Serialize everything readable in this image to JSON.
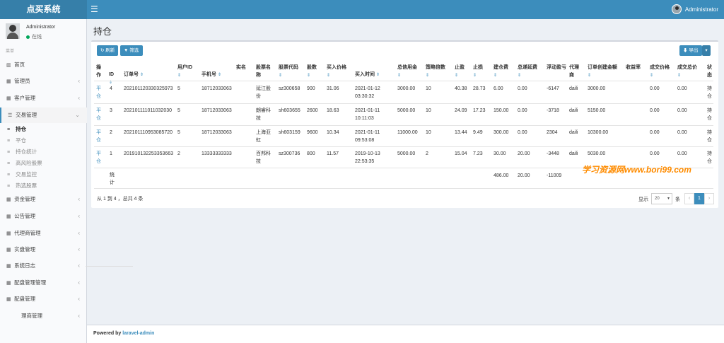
{
  "app": {
    "title": "点买系统",
    "user": "Administrator"
  },
  "sidebar": {
    "user_name": "Administrator",
    "status": "在线",
    "header": "菜单",
    "items": [
      {
        "label": "首页",
        "icon": "bar-chart-icon"
      },
      {
        "label": "管理员",
        "icon": "table-icon"
      },
      {
        "label": "客户管理",
        "icon": "table-icon"
      },
      {
        "label": "交易管理",
        "icon": "list-icon"
      }
    ],
    "sub_items": [
      {
        "label": "持仓"
      },
      {
        "label": "平仓"
      },
      {
        "label": "持仓统计"
      },
      {
        "label": "高风险股票"
      },
      {
        "label": "交易监控"
      },
      {
        "label": "热选股票"
      }
    ],
    "items_after": [
      {
        "label": "资金管理"
      },
      {
        "label": "公告管理"
      },
      {
        "label": "代理商管理"
      },
      {
        "label": "实盘管理"
      },
      {
        "label": "系统日志"
      },
      {
        "label": "配盘管理管理"
      },
      {
        "label": "配盘管理"
      },
      {
        "label": "理商管理"
      }
    ],
    "overlap_label": "管理"
  },
  "page": {
    "title": "持仓"
  },
  "toolbar": {
    "refresh": "刷新",
    "filter": "筛选",
    "export": "导出"
  },
  "table": {
    "headers": [
      "操作",
      "ID",
      "订单号",
      "用户ID",
      "手机号",
      "实名",
      "股票名称",
      "股票代码",
      "股数",
      "买入价格",
      "买入时间",
      "总信用金",
      "策略倍数",
      "止盈",
      "止损",
      "建仓费",
      "总递延费",
      "浮动盈亏",
      "代理商",
      "订单创建金额",
      "收益率",
      "成交价格",
      "成交总价",
      "状态"
    ],
    "rows": [
      {
        "action": "平仓",
        "id": "4",
        "order": "202101120330325973",
        "uid": "5",
        "phone": "18712033063",
        "name": "",
        "stock": "延江股份",
        "code": "sz300658",
        "shares": "900",
        "price": "31.06",
        "time": "2021-01-12 03:30:32",
        "credit": "3000.00",
        "multiple": "10",
        "tp": "40.38",
        "sl": "28.73",
        "fee": "6.00",
        "defer": "0.00",
        "pnl": "-6147",
        "agent": "daili",
        "amount": "3000.00",
        "rate": "",
        "deal_price": "0.00",
        "deal_total": "0.00",
        "status": "持仓"
      },
      {
        "action": "平仓",
        "id": "3",
        "order": "202101111011032030",
        "uid": "5",
        "phone": "18712033063",
        "name": "",
        "stock": "朗睿科技",
        "code": "sh603655",
        "shares": "2600",
        "price": "18.63",
        "time": "2021-01-11 10:11:03",
        "credit": "5000.00",
        "multiple": "10",
        "tp": "24.09",
        "sl": "17.23",
        "fee": "150.00",
        "defer": "0.00",
        "pnl": "-3718",
        "agent": "daili",
        "amount": "5150.00",
        "rate": "",
        "deal_price": "0.00",
        "deal_total": "0.00",
        "status": "持仓"
      },
      {
        "action": "平仓",
        "id": "2",
        "order": "202101110953085720",
        "uid": "5",
        "phone": "18712033063",
        "name": "",
        "stock": "上海亚虹",
        "code": "sh603159",
        "shares": "9600",
        "price": "10.34",
        "time": "2021-01-11 09:53:08",
        "credit": "11000.00",
        "multiple": "10",
        "tp": "13.44",
        "sl": "9.49",
        "fee": "300.00",
        "defer": "0.00",
        "pnl": "2304",
        "agent": "daili",
        "amount": "10300.00",
        "rate": "",
        "deal_price": "0.00",
        "deal_total": "0.00",
        "status": "持仓"
      },
      {
        "action": "平仓",
        "id": "1",
        "order": "201910132253353663",
        "uid": "2",
        "phone": "13333333333",
        "name": "",
        "stock": "百邦科技",
        "code": "sz300736",
        "shares": "800",
        "price": "11.57",
        "time": "2019-10-13 22:53:35",
        "credit": "5000.00",
        "multiple": "2",
        "tp": "15.04",
        "sl": "7.23",
        "fee": "30.00",
        "defer": "20.00",
        "pnl": "-3448",
        "agent": "daili",
        "amount": "5030.00",
        "rate": "",
        "deal_price": "0.00",
        "deal_total": "0.00",
        "status": "持仓"
      }
    ],
    "totals": {
      "label": "统计",
      "fee": "486.00",
      "defer": "20.00",
      "pnl": "-11009"
    }
  },
  "pagination": {
    "info": "从 1 到 4 ，总共 4 条",
    "show_label": "显示",
    "per_page": "20",
    "unit": "条",
    "prev": "‹",
    "page": "1",
    "next": "›"
  },
  "watermark": "学习资源网www.bori99.com",
  "footer": {
    "powered": "Powered by",
    "brand": "laravel-admin"
  }
}
